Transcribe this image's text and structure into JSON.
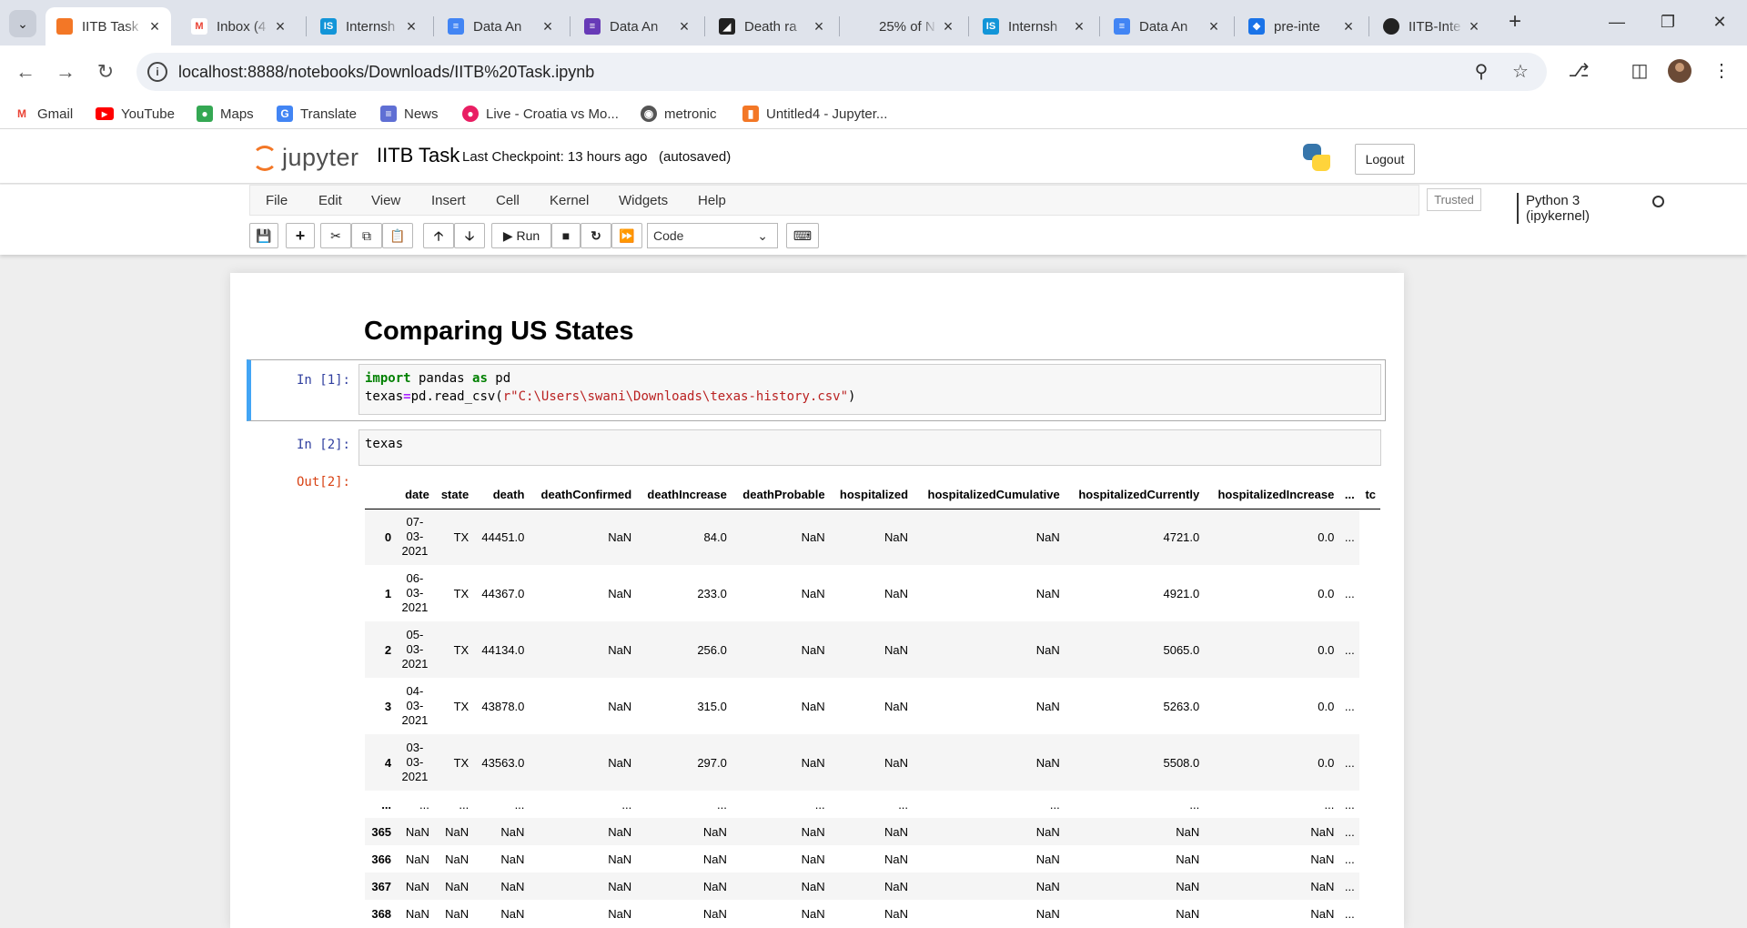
{
  "tabs": [
    {
      "title": "IITB Task",
      "icon": "jupyter-favicon",
      "active": true
    },
    {
      "title": "Inbox (4",
      "icon": "gmail-favicon"
    },
    {
      "title": "Internsh",
      "icon": "internshala-favicon"
    },
    {
      "title": "Data An",
      "icon": "google-docs-favicon"
    },
    {
      "title": "Data An",
      "icon": "forms-favicon"
    },
    {
      "title": "Death ra",
      "icon": "site-favicon"
    },
    {
      "title": "25% of N",
      "icon": "blank-favicon"
    },
    {
      "title": "Internsh",
      "icon": "internshala-favicon"
    },
    {
      "title": "Data An",
      "icon": "google-docs-favicon"
    },
    {
      "title": "pre-inte",
      "icon": "dropbox-favicon"
    },
    {
      "title": "IITB-Inte",
      "icon": "github-favicon"
    }
  ],
  "address": {
    "url": "localhost:8888/notebooks/Downloads/IITB%20Task.ipynb"
  },
  "bookmarks": [
    {
      "label": "Gmail",
      "icon": "gmail-icon"
    },
    {
      "label": "YouTube",
      "icon": "youtube-icon"
    },
    {
      "label": "Maps",
      "icon": "maps-icon"
    },
    {
      "label": "Translate",
      "icon": "translate-icon"
    },
    {
      "label": "News",
      "icon": "news-icon"
    },
    {
      "label": "Live - Croatia vs Mo...",
      "icon": "live-icon"
    },
    {
      "label": "metronic",
      "icon": "globe-icon"
    },
    {
      "label": "Untitled4 - Jupyter...",
      "icon": "jupyter-icon"
    }
  ],
  "jupyter": {
    "logo_text": "jupyter",
    "notebook_name": "IITB Task",
    "checkpoint": "Last Checkpoint: 13 hours ago",
    "autosaved": "(autosaved)",
    "logout": "Logout",
    "trusted": "Trusted",
    "kernel": "Python 3 (ipykernel)"
  },
  "menu": [
    "File",
    "Edit",
    "View",
    "Insert",
    "Cell",
    "Kernel",
    "Widgets",
    "Help"
  ],
  "toolbar": {
    "run_label": "Run",
    "cell_type": "Code"
  },
  "notebook": {
    "heading": "Comparing US States",
    "cell1_prompt": "In [1]:",
    "cell1_line1_kw1": "import",
    "cell1_line1_mod": " pandas ",
    "cell1_line1_kw2": "as",
    "cell1_line1_alias": " pd",
    "cell1_line2_a": "texas",
    "cell1_line2_eq": "=",
    "cell1_line2_b": "pd.read_csv(",
    "cell1_line2_str": "r\"C:\\Users\\swani\\Downloads\\texas-history.csv\"",
    "cell1_line2_c": ")",
    "cell2_prompt": "In [2]:",
    "cell2_code": "texas",
    "out_prompt": "Out[2]:"
  },
  "dataframe": {
    "columns": [
      "",
      "date",
      "state",
      "death",
      "deathConfirmed",
      "deathIncrease",
      "deathProbable",
      "hospitalized",
      "hospitalizedCumulative",
      "hospitalizedCurrently",
      "hospitalizedIncrease",
      "...",
      "tc"
    ],
    "rows": [
      {
        "idx": "0",
        "date": [
          "07-",
          "03-",
          "2021"
        ],
        "cells": [
          "TX",
          "44451.0",
          "NaN",
          "84.0",
          "NaN",
          "NaN",
          "NaN",
          "4721.0",
          "0.0",
          "..."
        ]
      },
      {
        "idx": "1",
        "date": [
          "06-",
          "03-",
          "2021"
        ],
        "cells": [
          "TX",
          "44367.0",
          "NaN",
          "233.0",
          "NaN",
          "NaN",
          "NaN",
          "4921.0",
          "0.0",
          "..."
        ]
      },
      {
        "idx": "2",
        "date": [
          "05-",
          "03-",
          "2021"
        ],
        "cells": [
          "TX",
          "44134.0",
          "NaN",
          "256.0",
          "NaN",
          "NaN",
          "NaN",
          "5065.0",
          "0.0",
          "..."
        ]
      },
      {
        "idx": "3",
        "date": [
          "04-",
          "03-",
          "2021"
        ],
        "cells": [
          "TX",
          "43878.0",
          "NaN",
          "315.0",
          "NaN",
          "NaN",
          "NaN",
          "5263.0",
          "0.0",
          "..."
        ]
      },
      {
        "idx": "4",
        "date": [
          "03-",
          "03-",
          "2021"
        ],
        "cells": [
          "TX",
          "43563.0",
          "NaN",
          "297.0",
          "NaN",
          "NaN",
          "NaN",
          "5508.0",
          "0.0",
          "..."
        ]
      },
      {
        "idx": "...",
        "date": [
          "..."
        ],
        "cells": [
          "...",
          "...",
          "...",
          "...",
          "...",
          "...",
          "...",
          "...",
          "...",
          "..."
        ]
      },
      {
        "idx": "365",
        "date": [
          "NaN"
        ],
        "cells": [
          "NaN",
          "NaN",
          "NaN",
          "NaN",
          "NaN",
          "NaN",
          "NaN",
          "NaN",
          "NaN",
          "..."
        ]
      },
      {
        "idx": "366",
        "date": [
          "NaN"
        ],
        "cells": [
          "NaN",
          "NaN",
          "NaN",
          "NaN",
          "NaN",
          "NaN",
          "NaN",
          "NaN",
          "NaN",
          "..."
        ]
      },
      {
        "idx": "367",
        "date": [
          "NaN"
        ],
        "cells": [
          "NaN",
          "NaN",
          "NaN",
          "NaN",
          "NaN",
          "NaN",
          "NaN",
          "NaN",
          "NaN",
          "..."
        ]
      },
      {
        "idx": "368",
        "date": [
          "NaN"
        ],
        "cells": [
          "NaN",
          "NaN",
          "NaN",
          "NaN",
          "NaN",
          "NaN",
          "NaN",
          "NaN",
          "NaN",
          "..."
        ]
      }
    ]
  },
  "colors": {
    "accent": "#42a5f5",
    "jupyter_orange": "#f37726",
    "prompt_in": "#303f9f",
    "prompt_out": "#d84315"
  }
}
